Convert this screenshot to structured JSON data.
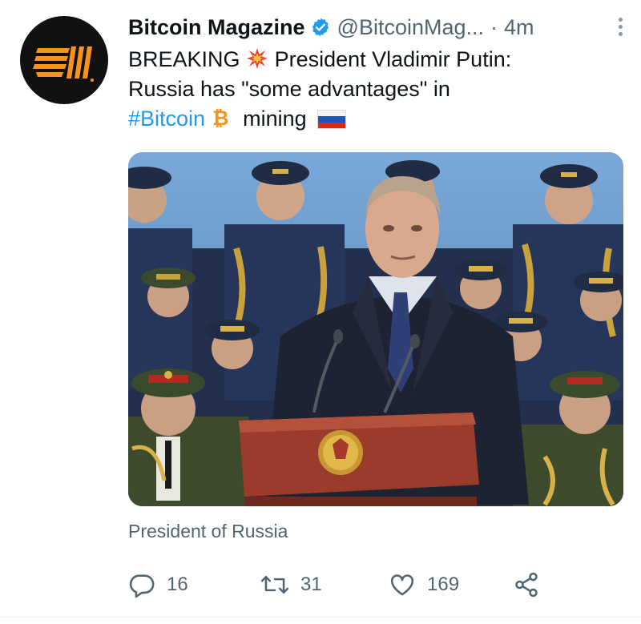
{
  "author": {
    "name": "Bitcoin Magazine",
    "handle": "@BitcoinMag...",
    "separator": "·",
    "time": "4m",
    "verified": true
  },
  "tweet": {
    "line1_text": "BREAKING",
    "line1_rest": "President Vladimir Putin:",
    "line2": "Russia has \"some advantages\" in",
    "hashtag": "#Bitcoin",
    "line3_rest": "mining"
  },
  "media": {
    "source_label": "President of Russia"
  },
  "actions": {
    "replies": "16",
    "retweets": "31",
    "likes": "169"
  },
  "colors": {
    "link": "#1d9bf0",
    "secondary_text": "#536471",
    "avatar_bg": "#111111",
    "logo_orange": "#f7931a"
  },
  "icons": [
    "bitcoin-magazine-logo",
    "verified-badge-icon",
    "more-icon",
    "collision-emoji",
    "bitcoin-emoji",
    "russia-flag-emoji",
    "reply-icon",
    "retweet-icon",
    "like-icon",
    "share-icon"
  ]
}
